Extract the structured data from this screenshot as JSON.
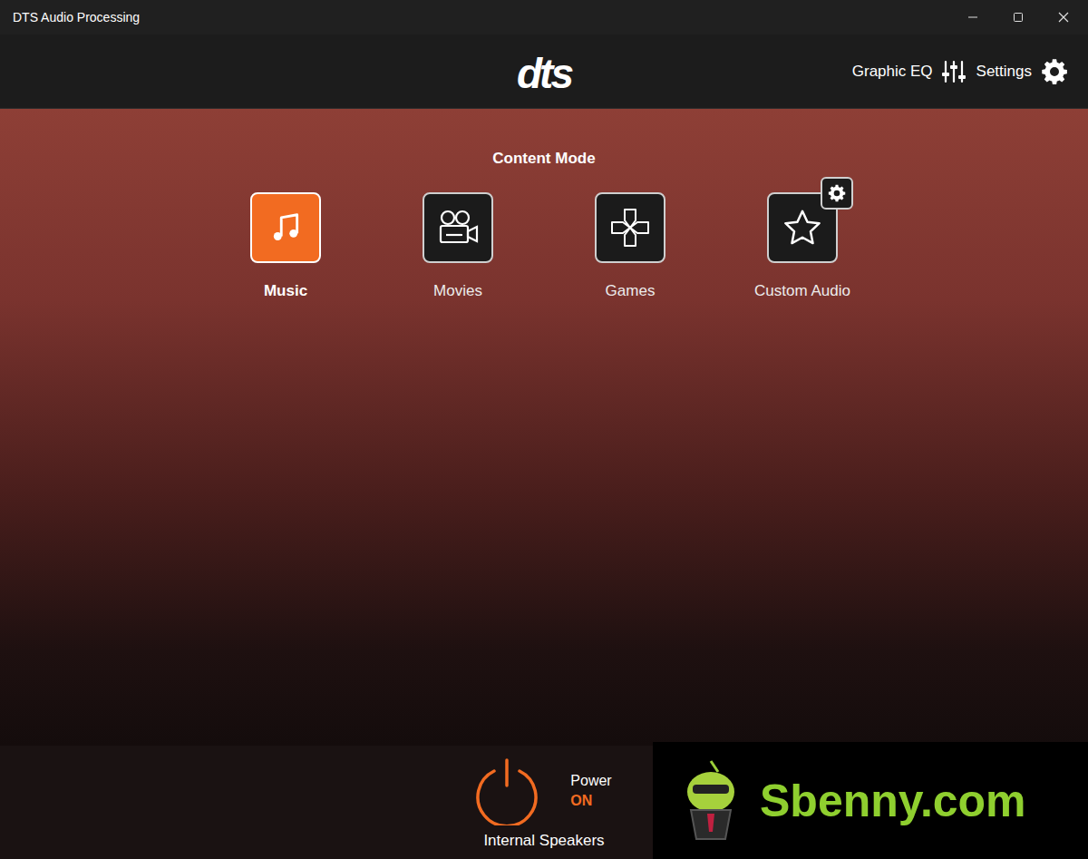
{
  "window": {
    "title": "DTS Audio Processing"
  },
  "header": {
    "logo": "dts",
    "graphic_eq": "Graphic EQ",
    "settings": "Settings"
  },
  "content_mode": {
    "title": "Content Mode",
    "modes": [
      {
        "label": "Music",
        "selected": true,
        "kind": "music",
        "settings_badge": false
      },
      {
        "label": "Movies",
        "selected": false,
        "kind": "movies",
        "settings_badge": false
      },
      {
        "label": "Games",
        "selected": false,
        "kind": "games",
        "settings_badge": false
      },
      {
        "label": "Custom Audio",
        "selected": false,
        "kind": "custom",
        "settings_badge": true
      }
    ]
  },
  "power": {
    "label": "Power",
    "state": "ON",
    "on": true
  },
  "output": "Internal Speakers",
  "watermark": "Sbenny.com"
}
